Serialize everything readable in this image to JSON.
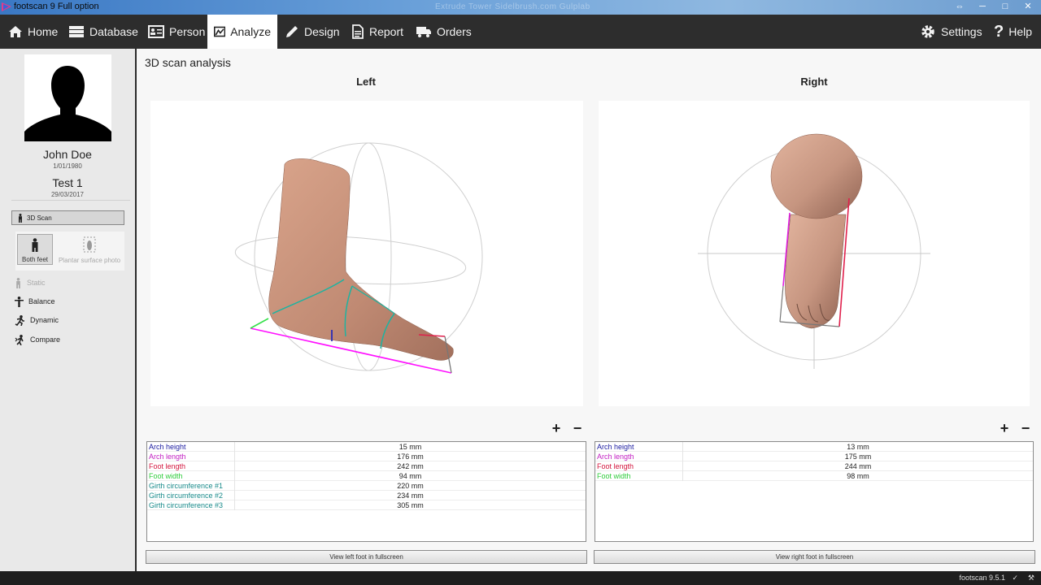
{
  "window": {
    "title": "footscan 9 Full option",
    "ghost_text": "Extrude   Tower Sidelbrush.com   Gulplab",
    "minimize": "─",
    "maximize": "□",
    "close": "✕",
    "restore": "⇔"
  },
  "nav": {
    "home": "Home",
    "database": "Database",
    "person": "Person",
    "analyze": "Analyze",
    "design": "Design",
    "report": "Report",
    "orders": "Orders",
    "settings": "Settings",
    "help": "Help"
  },
  "sidebar": {
    "name": "John Doe",
    "dob": "1/01/1980",
    "test": "Test 1",
    "test_date": "29/03/2017",
    "scan_button": "3D Scan",
    "both_feet": "Both feet",
    "plantar": "Plantar surface photo",
    "static": "Static",
    "balance": "Balance",
    "dynamic": "Dynamic",
    "compare": "Compare"
  },
  "main": {
    "title": "3D scan analysis",
    "left_title": "Left",
    "right_title": "Right",
    "zoom_in": "+",
    "zoom_out": "−",
    "left_fullscreen": "View left foot in fullscreen",
    "right_fullscreen": "View right foot in fullscreen"
  },
  "left_measurements": [
    {
      "label": "Arch height",
      "value": "15 mm",
      "color": "#1a1aa0"
    },
    {
      "label": "Arch length",
      "value": "176 mm",
      "color": "#c21ec2"
    },
    {
      "label": "Foot length",
      "value": "242 mm",
      "color": "#d3143c"
    },
    {
      "label": "Foot width",
      "value": "94 mm",
      "color": "#2ecc3a"
    },
    {
      "label": "Girth circumference #1",
      "value": "220 mm",
      "color": "#178a8a"
    },
    {
      "label": "Girth circumference #2",
      "value": "234 mm",
      "color": "#178a8a"
    },
    {
      "label": "Girth circumference #3",
      "value": "305 mm",
      "color": "#178a8a"
    }
  ],
  "right_measurements": [
    {
      "label": "Arch height",
      "value": "13 mm",
      "color": "#1a1aa0"
    },
    {
      "label": "Arch length",
      "value": "175 mm",
      "color": "#c21ec2"
    },
    {
      "label": "Foot length",
      "value": "244 mm",
      "color": "#d3143c"
    },
    {
      "label": "Foot width",
      "value": "98 mm",
      "color": "#2ecc3a"
    }
  ],
  "status": {
    "version": "footscan 9.5.1",
    "check_icon": "✓",
    "tools_icon": "⚒"
  }
}
